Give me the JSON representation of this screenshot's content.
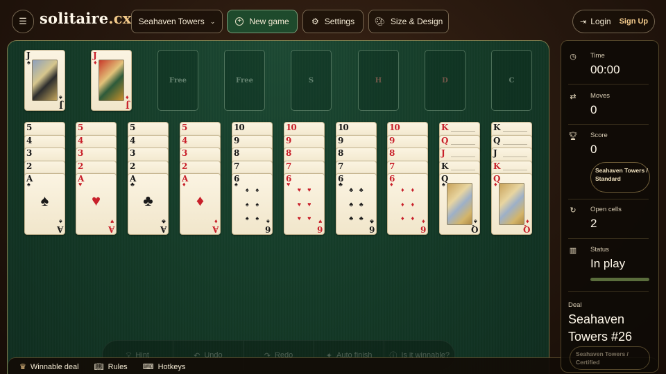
{
  "header": {
    "logo_main": "solitaire",
    "logo_tld": ".cx",
    "variant_label": "Seahaven Towers",
    "new_game_label": "New game",
    "settings_label": "Settings",
    "design_label": "Size & Design",
    "login_label": "Login",
    "signup_label": "Sign Up"
  },
  "board": {
    "free_slot_label": "Free",
    "foundations": [
      "S",
      "H",
      "D",
      "C"
    ],
    "free_cells": [
      {
        "rank": "J",
        "suit": "♠",
        "color": "black"
      },
      {
        "rank": "J",
        "suit": "♦",
        "color": "red"
      }
    ],
    "columns": [
      {
        "cards": [
          {
            "r": "5",
            "s": "♠",
            "c": "black"
          },
          {
            "r": "4",
            "s": "♠",
            "c": "black"
          },
          {
            "r": "3",
            "s": "♠",
            "c": "black"
          },
          {
            "r": "2",
            "s": "♠",
            "c": "black"
          },
          {
            "r": "A",
            "s": "♠",
            "c": "black"
          }
        ]
      },
      {
        "cards": [
          {
            "r": "5",
            "s": "♥",
            "c": "red"
          },
          {
            "r": "4",
            "s": "♥",
            "c": "red"
          },
          {
            "r": "3",
            "s": "♥",
            "c": "red"
          },
          {
            "r": "2",
            "s": "♥",
            "c": "red"
          },
          {
            "r": "A",
            "s": "♥",
            "c": "red"
          }
        ]
      },
      {
        "cards": [
          {
            "r": "5",
            "s": "♣",
            "c": "black"
          },
          {
            "r": "4",
            "s": "♣",
            "c": "black"
          },
          {
            "r": "3",
            "s": "♣",
            "c": "black"
          },
          {
            "r": "2",
            "s": "♣",
            "c": "black"
          },
          {
            "r": "A",
            "s": "♣",
            "c": "black"
          }
        ]
      },
      {
        "cards": [
          {
            "r": "5",
            "s": "♦",
            "c": "red"
          },
          {
            "r": "4",
            "s": "♦",
            "c": "red"
          },
          {
            "r": "3",
            "s": "♦",
            "c": "red"
          },
          {
            "r": "2",
            "s": "♦",
            "c": "red"
          },
          {
            "r": "A",
            "s": "♦",
            "c": "red"
          }
        ]
      },
      {
        "cards": [
          {
            "r": "10",
            "s": "♠",
            "c": "black"
          },
          {
            "r": "9",
            "s": "♠",
            "c": "black"
          },
          {
            "r": "8",
            "s": "♠",
            "c": "black"
          },
          {
            "r": "7",
            "s": "♠",
            "c": "black"
          },
          {
            "r": "6",
            "s": "♠",
            "c": "black"
          }
        ]
      },
      {
        "cards": [
          {
            "r": "10",
            "s": "♥",
            "c": "red"
          },
          {
            "r": "9",
            "s": "♥",
            "c": "red"
          },
          {
            "r": "8",
            "s": "♥",
            "c": "red"
          },
          {
            "r": "7",
            "s": "♥",
            "c": "red"
          },
          {
            "r": "6",
            "s": "♥",
            "c": "red"
          }
        ]
      },
      {
        "cards": [
          {
            "r": "10",
            "s": "♣",
            "c": "black"
          },
          {
            "r": "9",
            "s": "♣",
            "c": "black"
          },
          {
            "r": "8",
            "s": "♣",
            "c": "black"
          },
          {
            "r": "7",
            "s": "♣",
            "c": "black"
          },
          {
            "r": "6",
            "s": "♣",
            "c": "black"
          }
        ]
      },
      {
        "cards": [
          {
            "r": "10",
            "s": "♦",
            "c": "red"
          },
          {
            "r": "9",
            "s": "♦",
            "c": "red"
          },
          {
            "r": "8",
            "s": "♦",
            "c": "red"
          },
          {
            "r": "7",
            "s": "♦",
            "c": "red"
          },
          {
            "r": "6",
            "s": "♦",
            "c": "red"
          }
        ]
      },
      {
        "cards": [
          {
            "r": "K",
            "s": "♥",
            "c": "red"
          },
          {
            "r": "Q",
            "s": "♥",
            "c": "red"
          },
          {
            "r": "J",
            "s": "♥",
            "c": "red"
          },
          {
            "r": "K",
            "s": "♠",
            "c": "black"
          },
          {
            "r": "Q",
            "s": "♠",
            "c": "black"
          }
        ]
      },
      {
        "cards": [
          {
            "r": "K",
            "s": "♣",
            "c": "black"
          },
          {
            "r": "Q",
            "s": "♣",
            "c": "black"
          },
          {
            "r": "J",
            "s": "♣",
            "c": "black"
          },
          {
            "r": "K",
            "s": "♦",
            "c": "red"
          },
          {
            "r": "Q",
            "s": "♦",
            "c": "red"
          }
        ]
      }
    ]
  },
  "actions": {
    "hint": "Hint",
    "undo": "Undo",
    "redo": "Redo",
    "auto_finish": "Auto finish",
    "winnable": "Is it winnable?"
  },
  "footer": {
    "winnable_deal": "Winnable deal",
    "rules": "Rules",
    "hotkeys": "Hotkeys"
  },
  "panel": {
    "time_label": "Time",
    "time_value": "00:00",
    "moves_label": "Moves",
    "moves_value": "0",
    "score_label": "Score",
    "score_value": "0",
    "score_badge": "Seahaven Towers / Standard",
    "open_cells_label": "Open cells",
    "open_cells_value": "2",
    "status_label": "Status",
    "status_value": "In play",
    "deal_label": "Deal",
    "deal_name": "Seahaven Towers #26",
    "deal_badge": "Seahaven Towers / Certified"
  },
  "colors": {
    "felt": "#143a27",
    "accent_gold": "#f2c98a",
    "card_red": "#c8202a",
    "new_game_bg": "#1e4a2c"
  }
}
